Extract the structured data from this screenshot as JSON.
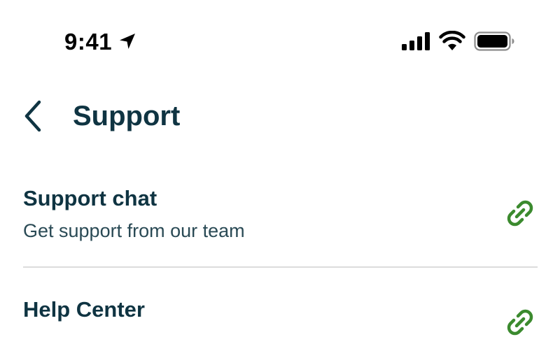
{
  "status_bar": {
    "time": "9:41",
    "icons": [
      "location-arrow-icon",
      "cellular-signal-icon",
      "wifi-icon",
      "battery-icon"
    ]
  },
  "header": {
    "back_icon": "chevron-left-icon",
    "title": "Support"
  },
  "list": {
    "items": [
      {
        "title": "Support chat",
        "subtitle": "Get support from our team",
        "icon": "link-icon"
      },
      {
        "title": "Help Center",
        "icon": "link-icon"
      }
    ]
  },
  "colors": {
    "text_primary": "#0f3442",
    "text_secondary": "#2a4a55",
    "link_icon": "#3b8a2e",
    "divider": "#dcdcdc",
    "background": "#ffffff"
  }
}
